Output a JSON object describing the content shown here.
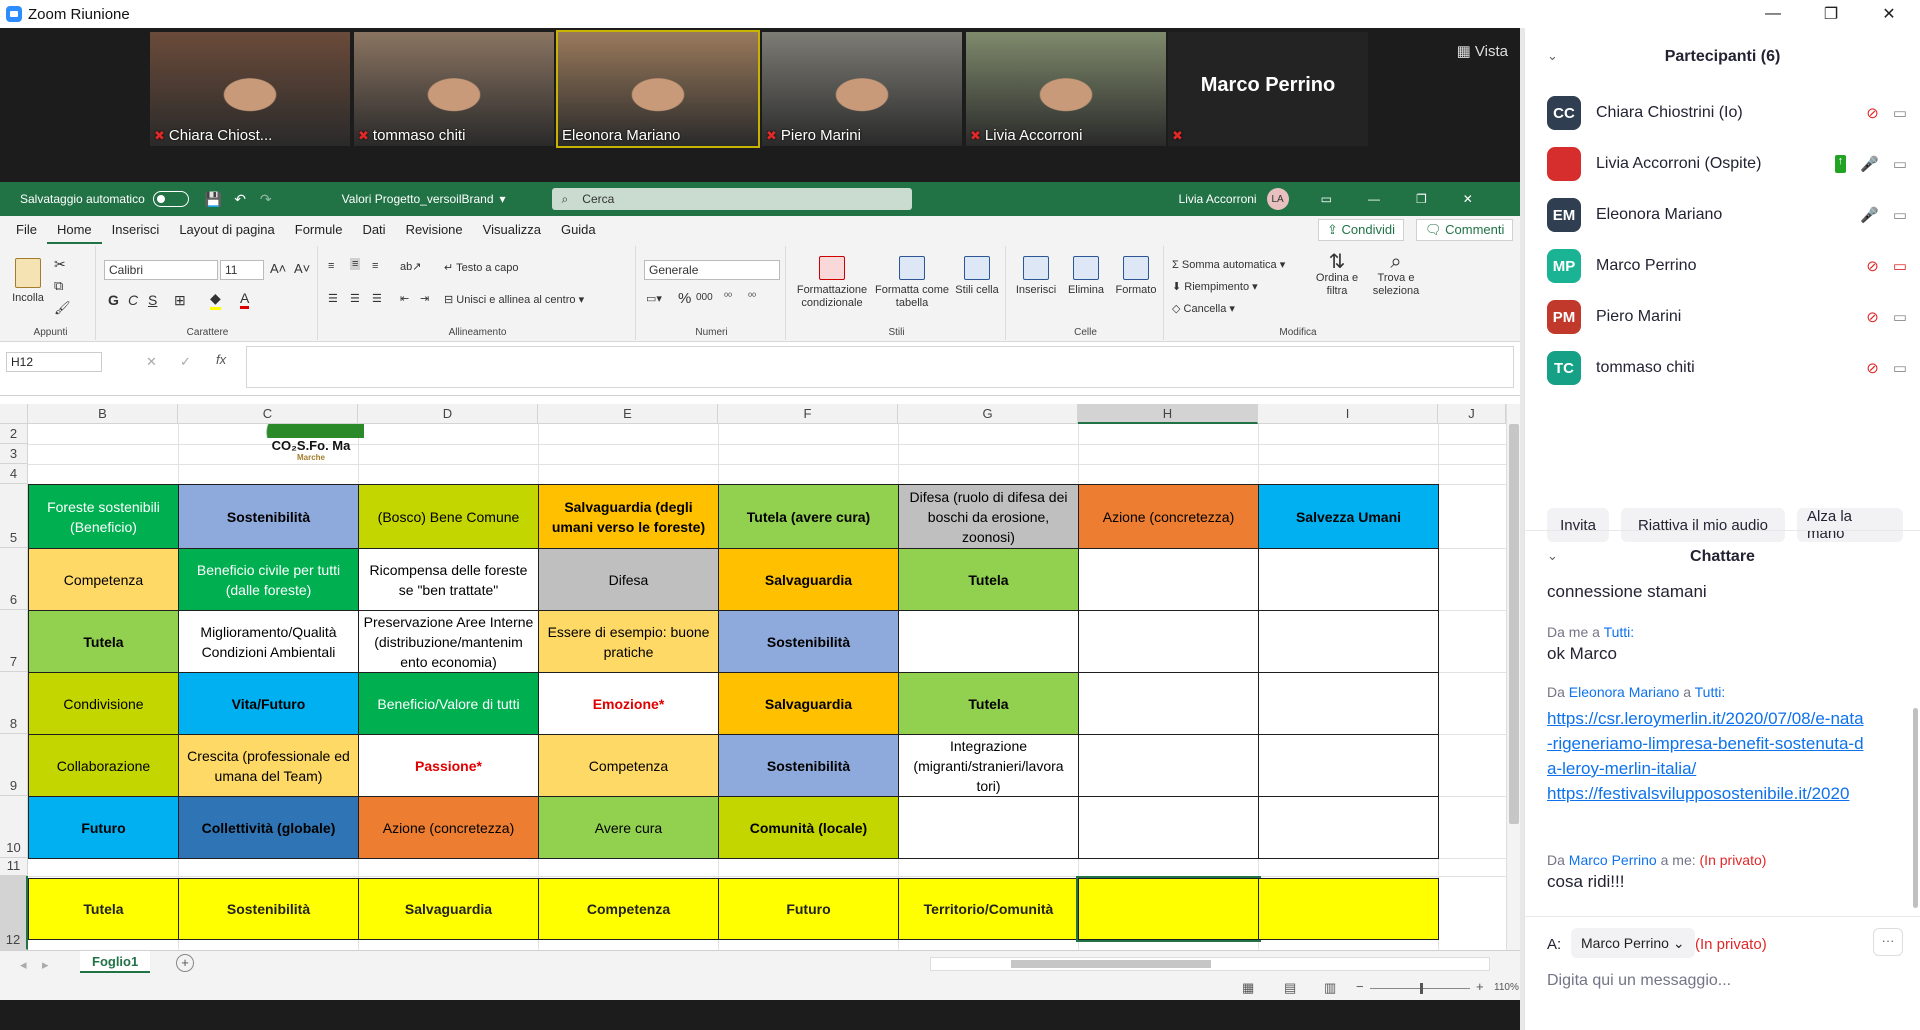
{
  "window": {
    "title": "Zoom Riunione",
    "minimize": "—",
    "restore": "❐",
    "close": "✕"
  },
  "video": {
    "view_label": "Vista",
    "tiles": [
      {
        "name": "Chiara Chiost...",
        "bg": "#6b4b3a"
      },
      {
        "name": "tommaso chiti",
        "bg": "#8a7461"
      },
      {
        "name": "Eleonora Mariano",
        "bg": "#9a7a5c"
      },
      {
        "name": "Piero Marini",
        "bg": "#7d7c75"
      },
      {
        "name": "Livia Accorroni",
        "bg": "#7f8a6c"
      }
    ],
    "speaker_name": "Marco Perrino"
  },
  "excel": {
    "autosave_label": "Salvataggio automatico",
    "file_name": "Valori Progetto_versoilBrand",
    "search_placeholder": "Cerca",
    "user": "Livia Accorroni",
    "user_initials": "LA",
    "tabs": [
      "File",
      "Home",
      "Inserisci",
      "Layout di pagina",
      "Formule",
      "Dati",
      "Revisione",
      "Visualizza",
      "Guida"
    ],
    "share_label": "Condividi",
    "comments_label": "Commenti",
    "ribbon": {
      "paste": "Incolla",
      "clipboard_group": "Appunti",
      "font_name": "Calibri",
      "font_size": "11",
      "font_group": "Carattere",
      "wrap_text": "Testo a capo",
      "merge_center": "Unisci e allinea al centro",
      "alignment_group": "Allineamento",
      "number_format": "Generale",
      "number_group": "Numeri",
      "cond_format": "Formattazione condizionale",
      "format_table": "Formatta come tabella",
      "cell_styles": "Stili cella",
      "styles_group": "Stili",
      "insert": "Inserisci",
      "delete": "Elimina",
      "format": "Formato",
      "cells_group": "Celle",
      "autosum": "Somma automatica",
      "fill": "Riempimento",
      "clear": "Cancella",
      "sort_filter": "Ordina e filtra",
      "find_select": "Trova e seleziona",
      "editing_group": "Modifica"
    },
    "name_box": "H12",
    "columns": [
      "B",
      "C",
      "D",
      "E",
      "F",
      "G",
      "H",
      "I",
      "J"
    ],
    "rows": [
      "2",
      "3",
      "4",
      "5",
      "6",
      "7",
      "8",
      "9",
      "10",
      "11",
      "12"
    ],
    "logo_text": "CO₂S.Fo. Ma",
    "logo_sub": "Marche",
    "table": [
      [
        {
          "t": "Foreste sostenibili (Beneficio)",
          "bg": "#00B050",
          "c": "#fff",
          "b": false
        },
        {
          "t": "Sostenibilità",
          "bg": "#8EA9DB",
          "c": "#000",
          "b": true
        },
        {
          "t": "(Bosco) Bene Comune",
          "bg": "#C4D600",
          "c": "#000",
          "b": false
        },
        {
          "t": "Salvaguardia (degli umani verso le foreste)",
          "bg": "#FFC000",
          "c": "#000",
          "b": true
        },
        {
          "t": "Tutela (avere cura)",
          "bg": "#92D050",
          "c": "#000",
          "b": true
        },
        {
          "t": "Difesa (ruolo di difesa dei boschi da erosione, zoonosi)",
          "bg": "#BFBFBF",
          "c": "#000",
          "b": false
        },
        {
          "t": "Azione (concretezza)",
          "bg": "#ED7D31",
          "c": "#000",
          "b": false
        },
        {
          "t": "Salvezza Umani",
          "bg": "#00B0F0",
          "c": "#000",
          "b": true
        }
      ],
      [
        {
          "t": "Competenza",
          "bg": "#FFD966",
          "c": "#000",
          "b": false
        },
        {
          "t": "Beneficio civile per tutti (dalle foreste)",
          "bg": "#00B050",
          "c": "#fff",
          "b": false
        },
        {
          "t": "Ricompensa delle foreste se \"ben trattate\"",
          "bg": "#fff",
          "c": "#000",
          "b": false
        },
        {
          "t": "Difesa",
          "bg": "#BFBFBF",
          "c": "#000",
          "b": false
        },
        {
          "t": "Salvaguardia",
          "bg": "#FFC000",
          "c": "#000",
          "b": true
        },
        {
          "t": "Tutela",
          "bg": "#92D050",
          "c": "#000",
          "b": true
        },
        {
          "t": "",
          "bg": "#fff",
          "c": "#000",
          "b": false
        },
        {
          "t": "",
          "bg": "#fff",
          "c": "#000",
          "b": false
        }
      ],
      [
        {
          "t": "Tutela",
          "bg": "#92D050",
          "c": "#000",
          "b": true
        },
        {
          "t": "Miglioramento/Qualità Condizioni Ambientali",
          "bg": "#fff",
          "c": "#000",
          "b": false
        },
        {
          "t": "Preservazione Aree Interne (distribuzione/mantenim ento economia)",
          "bg": "#fff",
          "c": "#000",
          "b": false
        },
        {
          "t": "Essere di esempio: buone pratiche",
          "bg": "#FFD966",
          "c": "#000",
          "b": false
        },
        {
          "t": "Sostenibilità",
          "bg": "#8EA9DB",
          "c": "#000",
          "b": true
        },
        {
          "t": "",
          "bg": "#fff",
          "c": "#000",
          "b": false
        },
        {
          "t": "",
          "bg": "#fff",
          "c": "#000",
          "b": false
        },
        {
          "t": "",
          "bg": "#fff",
          "c": "#000",
          "b": false
        }
      ],
      [
        {
          "t": "Condivisione",
          "bg": "#C4D600",
          "c": "#000",
          "b": false
        },
        {
          "t": "Vita/Futuro",
          "bg": "#00B0F0",
          "c": "#000",
          "b": true
        },
        {
          "t": "Beneficio/Valore di tutti",
          "bg": "#00B050",
          "c": "#fff",
          "b": false
        },
        {
          "t": "Emozione*",
          "bg": "#fff",
          "c": "#E00000",
          "b": true
        },
        {
          "t": "Salvaguardia",
          "bg": "#FFC000",
          "c": "#000",
          "b": true
        },
        {
          "t": "Tutela",
          "bg": "#92D050",
          "c": "#000",
          "b": true
        },
        {
          "t": "",
          "bg": "#fff",
          "c": "#000",
          "b": false
        },
        {
          "t": "",
          "bg": "#fff",
          "c": "#000",
          "b": false
        }
      ],
      [
        {
          "t": "Collaborazione",
          "bg": "#C4D600",
          "c": "#000",
          "b": false
        },
        {
          "t": "Crescita (professionale ed umana del Team)",
          "bg": "#FFD966",
          "c": "#000",
          "b": false
        },
        {
          "t": "Passione*",
          "bg": "#fff",
          "c": "#E00000",
          "b": true
        },
        {
          "t": "Competenza",
          "bg": "#FFD966",
          "c": "#000",
          "b": false
        },
        {
          "t": "Sostenibilità",
          "bg": "#8EA9DB",
          "c": "#000",
          "b": true
        },
        {
          "t": "Integrazione (migranti/stranieri/lavora tori)",
          "bg": "#fff",
          "c": "#000",
          "b": false
        },
        {
          "t": "",
          "bg": "#fff",
          "c": "#000",
          "b": false
        },
        {
          "t": "",
          "bg": "#fff",
          "c": "#000",
          "b": false
        }
      ],
      [
        {
          "t": "Futuro",
          "bg": "#00B0F0",
          "c": "#000",
          "b": true
        },
        {
          "t": "Collettività (globale)",
          "bg": "#2F75B5",
          "c": "#000",
          "b": true
        },
        {
          "t": "Azione (concretezza)",
          "bg": "#ED7D31",
          "c": "#000",
          "b": false
        },
        {
          "t": "Avere cura",
          "bg": "#92D050",
          "c": "#000",
          "b": false
        },
        {
          "t": "Comunità (locale)",
          "bg": "#C4D600",
          "c": "#000",
          "b": true
        },
        {
          "t": "",
          "bg": "#fff",
          "c": "#000",
          "b": false
        },
        {
          "t": "",
          "bg": "#fff",
          "c": "#000",
          "b": false
        },
        {
          "t": "",
          "bg": "#fff",
          "c": "#000",
          "b": false
        }
      ]
    ],
    "summary_row": [
      "Tutela",
      "Sostenibilità",
      "Salvaguardia",
      "Competenza",
      "Futuro",
      "Territorio/Comunità",
      "",
      ""
    ],
    "summary_color": "#FFFF00",
    "sheet_tab": "Foglio1",
    "zoom": "110%"
  },
  "participants": {
    "title": "Partecipanti (6)",
    "list": [
      {
        "initials": "CC",
        "name": "Chiara Chiostrini (Io)",
        "color": "#2f3e50"
      },
      {
        "initials": "",
        "name": "Livia Accorroni (Ospite)",
        "color": "#d62d2d"
      },
      {
        "initials": "EM",
        "name": "Eleonora Mariano",
        "color": "#2f3e50"
      },
      {
        "initials": "MP",
        "name": "Marco Perrino",
        "color": "#1ab394"
      },
      {
        "initials": "PM",
        "name": "Piero Marini",
        "color": "#c0392b"
      },
      {
        "initials": "TC",
        "name": "tommaso chiti",
        "color": "#16a085"
      }
    ],
    "invite": "Invita",
    "unmute": "Riattiva il mio audio",
    "raise_hand": "Alza la mano"
  },
  "chat": {
    "title": "Chattare",
    "first_line": "connessione stamani",
    "m1_from": "Da me a",
    "m1_to": "Tutti:",
    "m1_text": "ok Marco",
    "m2_from": "Da",
    "m2_sender": "Eleonora Mariano",
    "m2_a": "a",
    "m2_to": "Tutti:",
    "m2_link1": "https://csr.leroymerlin.it/2020/07/08/e-nata-rigeneriamo-limpresa-benefit-sostenuta-da-leroy-merlin-italia/",
    "m2_link2": "https://festivalsviluppo​sostenibile.it/2020",
    "m3_from": "Da",
    "m3_sender": "Marco Perrino",
    "m3_to": "a me:",
    "m3_priv": "(In privato)",
    "m3_text": "cosa ridi!!!",
    "to_label": "A:",
    "recipient": "Marco Perrino",
    "recipient_priv": "(In privato)",
    "input_placeholder": "Digita qui un messaggio..."
  }
}
